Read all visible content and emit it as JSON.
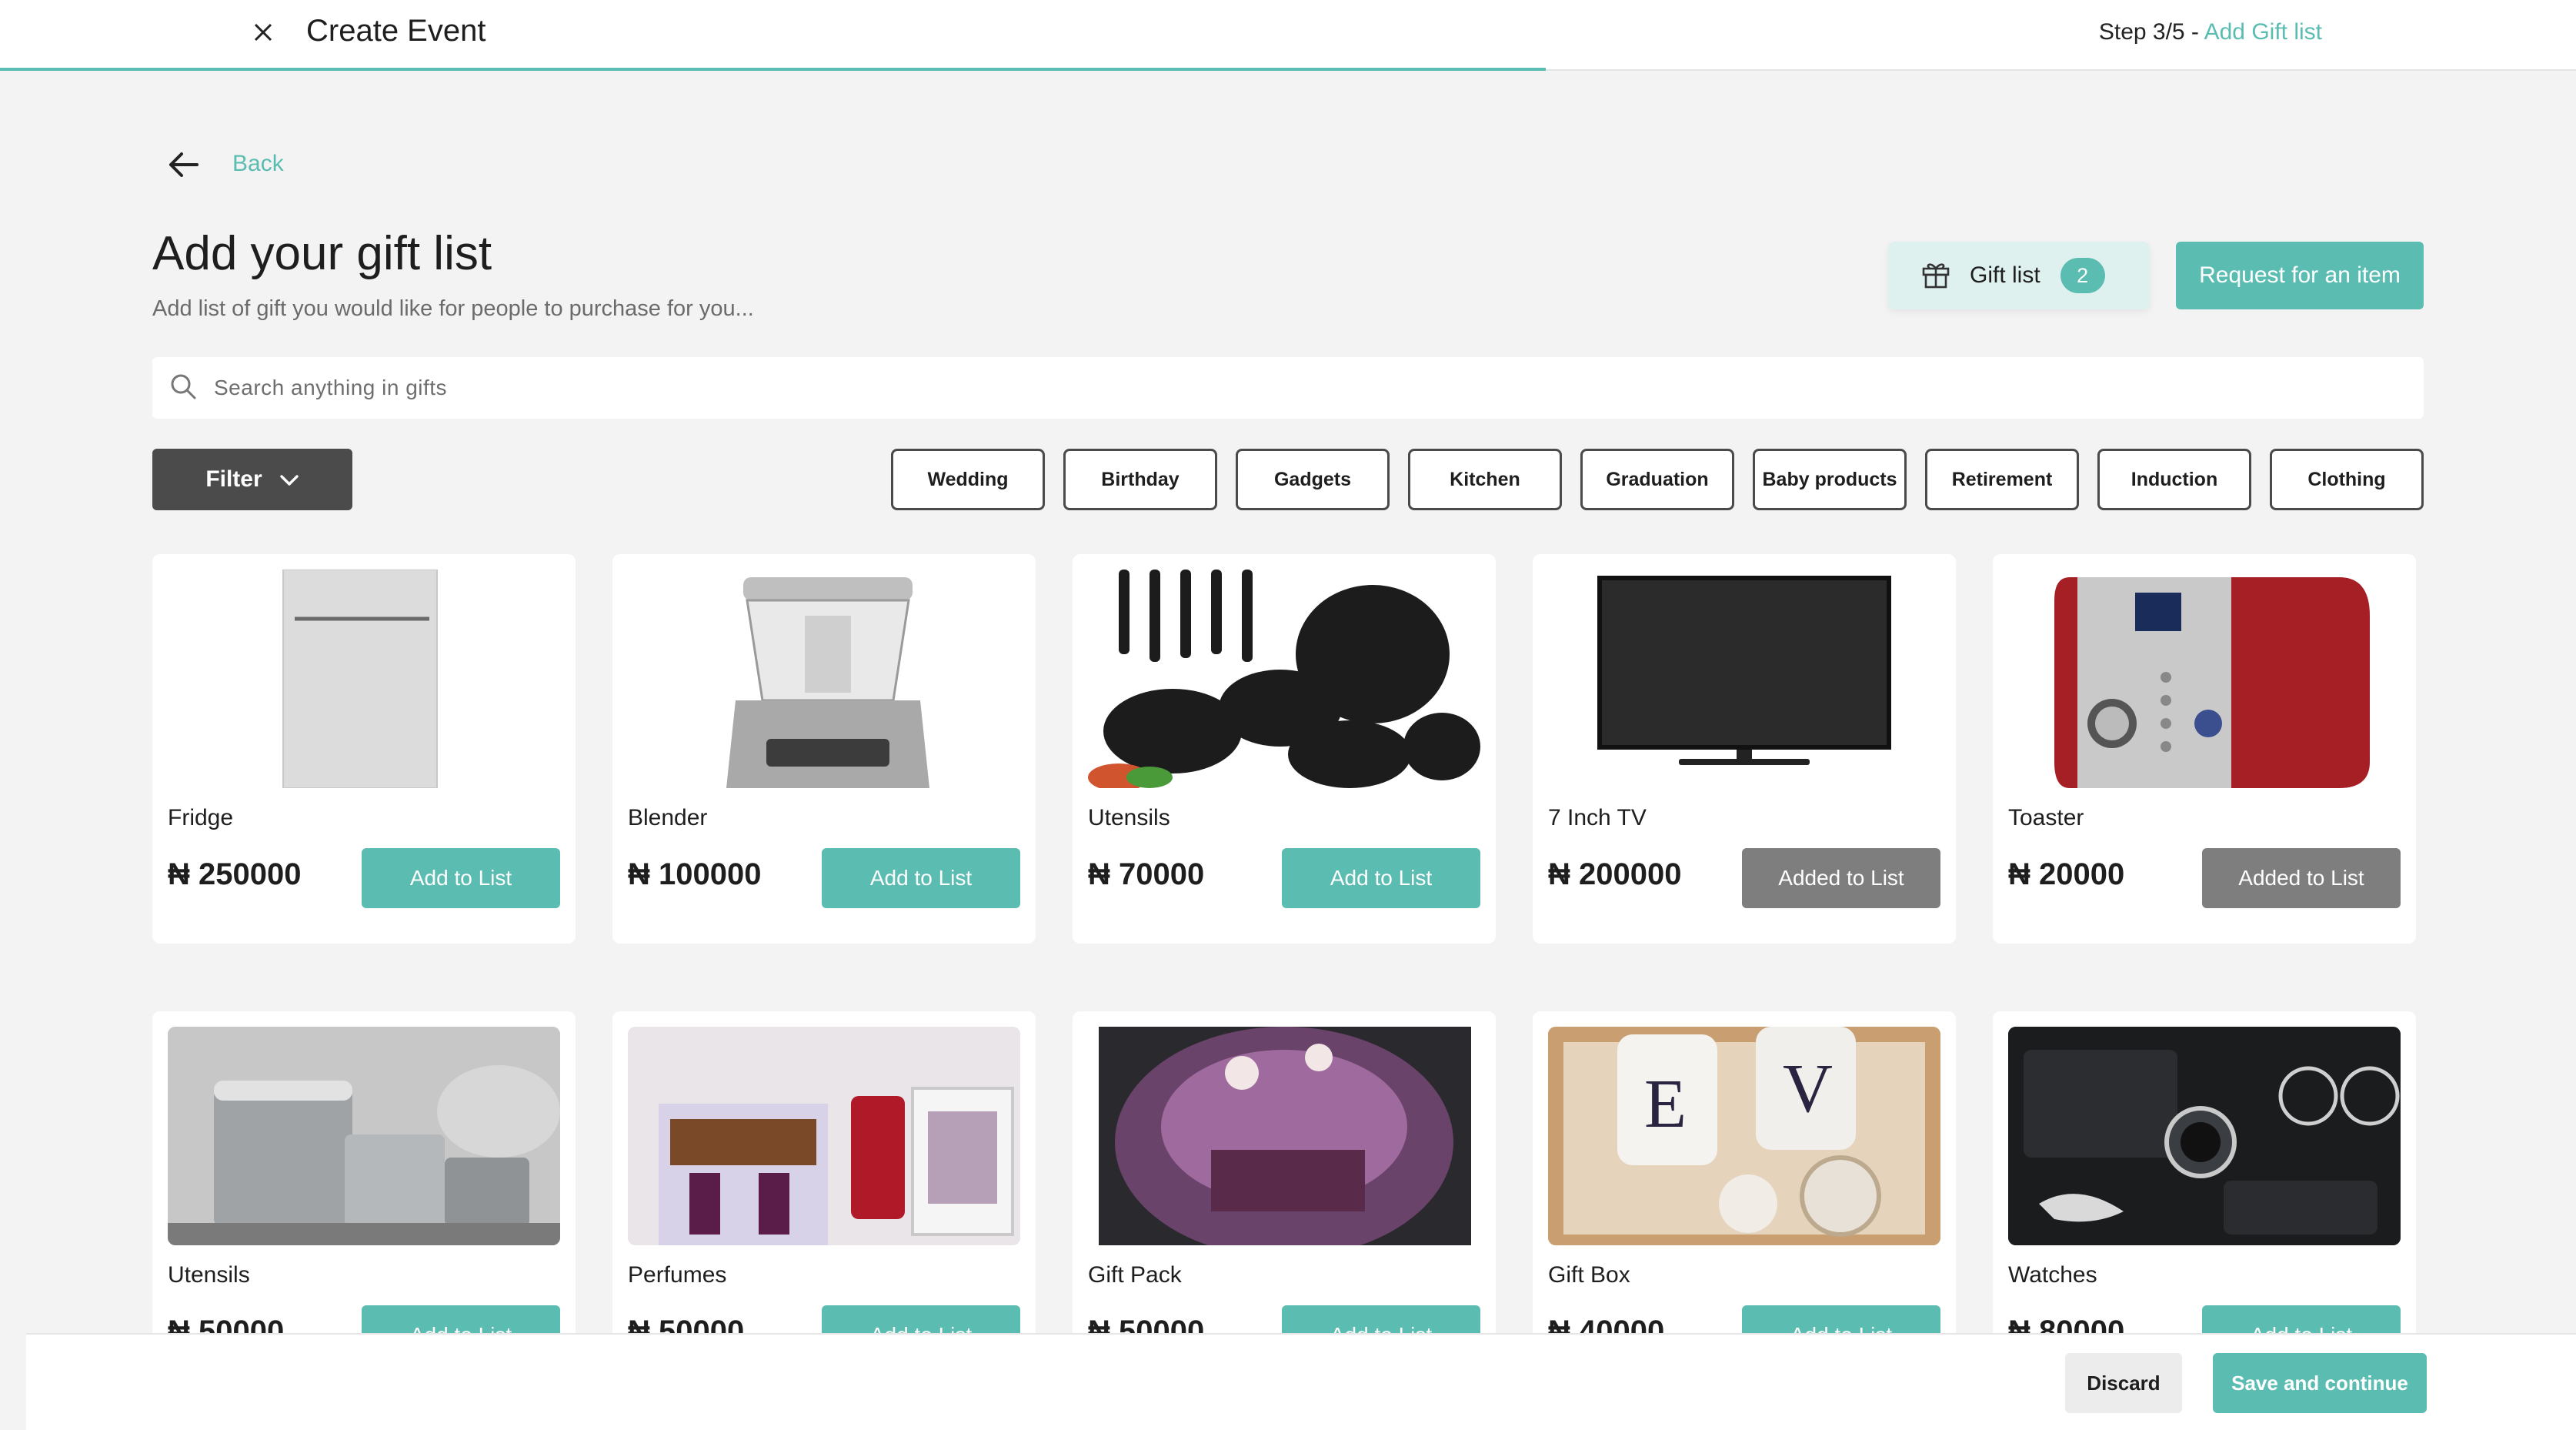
{
  "header": {
    "title": "Create Event",
    "step_prefix": "Step 3/5 - ",
    "step_name": "Add Gift list",
    "progress_fraction": 0.6
  },
  "back_label": "Back",
  "page": {
    "title": "Add your gift list",
    "subtitle": "Add list of gift you would like for people to purchase for you..."
  },
  "gift_list": {
    "label": "Gift list",
    "count": "2"
  },
  "request_label": "Request for an item",
  "search": {
    "placeholder": "Search anything in gifts"
  },
  "filter_label": "Filter",
  "categories": [
    "Wedding",
    "Birthday",
    "Gadgets",
    "Kitchen",
    "Graduation",
    "Baby products",
    "Retirement",
    "Induction",
    "Clothing"
  ],
  "products": [
    {
      "name": "Fridge",
      "price": "₦ 250000",
      "button": "Add to List",
      "state": "add",
      "icon": "fridge-icon"
    },
    {
      "name": "Blender",
      "price": "₦ 100000",
      "button": "Add to List",
      "state": "add",
      "icon": "blender-icon"
    },
    {
      "name": "Utensils",
      "price": "₦ 70000",
      "button": "Add to List",
      "state": "add",
      "icon": "cookware-icon"
    },
    {
      "name": "7 Inch TV",
      "price": "₦ 200000",
      "button": "Added to List",
      "state": "added",
      "icon": "tv-icon"
    },
    {
      "name": "Toaster",
      "price": "₦ 20000",
      "button": "Added to List",
      "state": "added",
      "icon": "toaster-icon"
    },
    {
      "name": "Utensils",
      "price": "₦ 50000",
      "button": "Add to List",
      "state": "add",
      "icon": "pots-icon"
    },
    {
      "name": "Perfumes",
      "price": "₦ 50000",
      "button": "Add to List",
      "state": "add",
      "icon": "perfume-icon"
    },
    {
      "name": "Gift Pack",
      "price": "₦ 50000",
      "button": "Add to List",
      "state": "add",
      "icon": "gift-pack-icon"
    },
    {
      "name": "Gift Box",
      "price": "₦ 40000",
      "button": "Add to List",
      "state": "add",
      "icon": "gift-box-icon"
    },
    {
      "name": "Watches",
      "price": "₦ 80000",
      "button": "Add to List",
      "state": "add",
      "icon": "watch-icon"
    }
  ],
  "footer": {
    "discard": "Discard",
    "save": "Save and continue"
  },
  "colors": {
    "accent": "#5bbdb2",
    "added": "#7e7e7e",
    "filter": "#4b4b4b"
  }
}
